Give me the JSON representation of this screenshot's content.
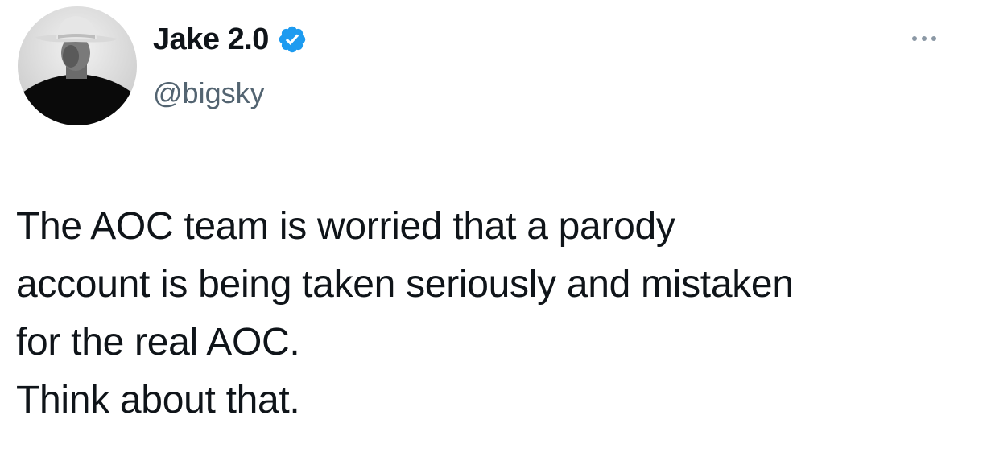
{
  "tweet": {
    "author": {
      "display_name": "Jake 2.0",
      "handle": "@bigsky",
      "verified": true,
      "verified_icon": "verified-badge-icon",
      "avatar": "avatar-cowboy-hat-photo"
    },
    "more_icon": "more-options-icon",
    "text_lines": [
      "The AOC team is worried that a parody",
      "account is being taken seriously and mistaken",
      "for the real AOC.",
      "Think about that."
    ]
  },
  "colors": {
    "text_primary": "#0f1419",
    "text_secondary": "#536471",
    "verified_blue": "#1d9bf0",
    "more_dots": "#8b98a5"
  }
}
